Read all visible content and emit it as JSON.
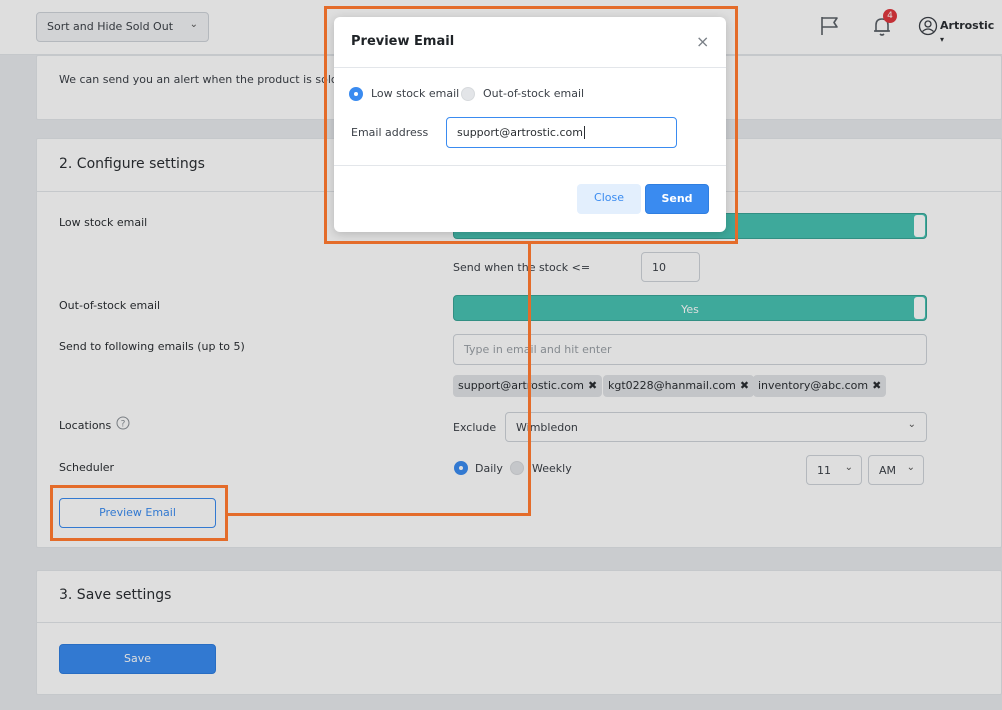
{
  "topbar": {
    "sort_select": "Sort and Hide Sold Out",
    "notifications_count": "4",
    "user_name": "Artrostic"
  },
  "card1": {
    "text": "We can send you an alert when the product is sold o"
  },
  "configure": {
    "title": "2. Configure settings",
    "low_stock_label": "Low stock email",
    "send_when_label": "Send when the stock <=",
    "stock_threshold": "10",
    "out_of_stock_label": "Out-of-stock email",
    "out_of_stock_toggle": "Yes",
    "emails_label": "Send to following emails (up to 5)",
    "emails_placeholder": "Type in email and hit enter",
    "emails": [
      "support@artrostic.com",
      "kgt0228@hanmail.com",
      "inventory@abc.com"
    ],
    "locations_label": "Locations",
    "exclude_label": "Exclude",
    "location_value": "Wimbledon",
    "scheduler_label": "Scheduler",
    "daily_label": "Daily",
    "weekly_label": "Weekly",
    "hour_value": "11",
    "ampm_value": "AM",
    "preview_button": "Preview Email"
  },
  "save_section": {
    "title": "3. Save settings",
    "save_button": "Save"
  },
  "modal": {
    "title": "Preview Email",
    "option_low": "Low stock email",
    "option_out": "Out-of-stock email",
    "email_label": "Email address",
    "email_value": "support@artrostic.com",
    "close_button": "Close",
    "send_button": "Send"
  },
  "colors": {
    "accent": "#3a8bf0",
    "toggle_green": "#48c3b3",
    "callout_orange": "#e46c2a",
    "badge_red": "#e0383e"
  }
}
